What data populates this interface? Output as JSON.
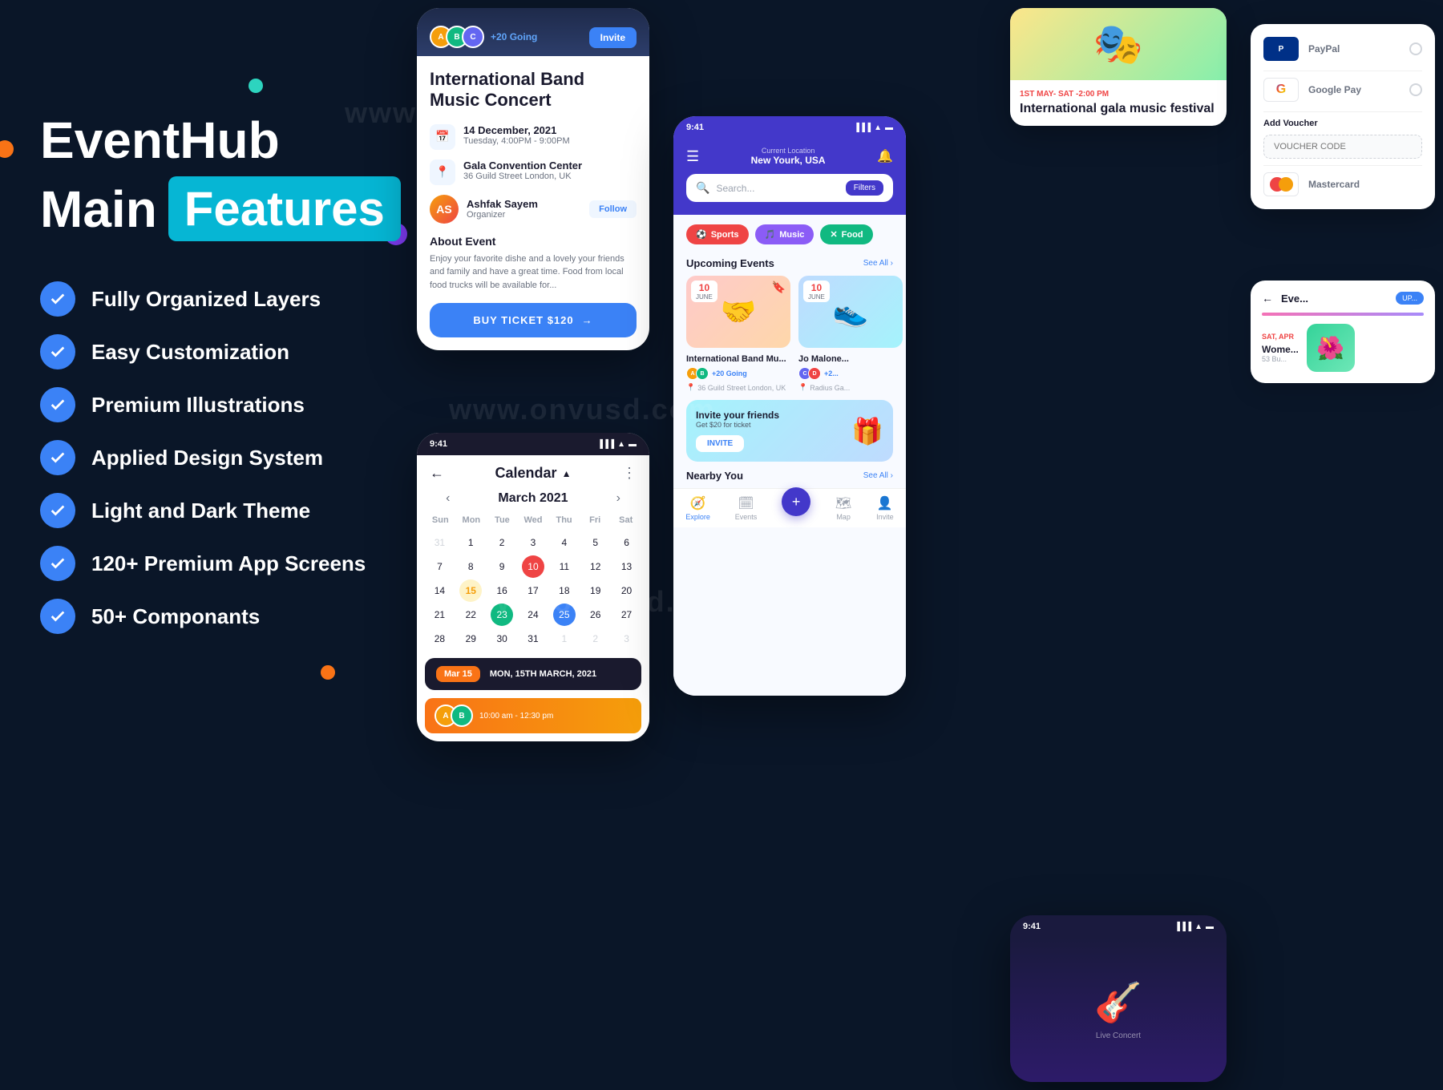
{
  "app": {
    "name": "EventHub",
    "subtitle": "Main",
    "badge": "Features"
  },
  "features": [
    {
      "label": "Fully Organized Layers"
    },
    {
      "label": "Easy Customization"
    },
    {
      "label": "Premium Illustrations"
    },
    {
      "label": "Applied Design System"
    },
    {
      "label": "Light and Dark Theme"
    },
    {
      "label": "120+ Premium App Screens"
    },
    {
      "label": "50+ Componants"
    }
  ],
  "phone1": {
    "going_text": "+20 Going",
    "invite_label": "Invite",
    "event_title": "International Band Music Concert",
    "date": "14 December, 2021",
    "date_sub": "Tuesday, 4:00PM - 9:00PM",
    "venue": "Gala Convention Center",
    "venue_sub": "36 Guild Street London, UK",
    "organizer": "Ashfak Sayem",
    "organizer_role": "Organizer",
    "follow_label": "Follow",
    "about_title": "About Event",
    "about_text": "Enjoy your favorite dishe and a lovely your friends and family and have a great time. Food from local food trucks will be available for...",
    "buy_label": "BUY TICKET $120"
  },
  "phone2": {
    "time": "9:41",
    "cal_title": "Calendar",
    "month": "March 2021",
    "days": [
      "Sun",
      "Mon",
      "Tue",
      "Wed",
      "Thu",
      "Fri",
      "Sat"
    ],
    "selected_date_label": "Mar 15",
    "selected_day_text": "MON, 15TH MARCH, 2021",
    "event_time": "10:00 am - 12:30 pm"
  },
  "phone3": {
    "time": "9:41",
    "location_label": "Current Location",
    "location": "New Yourk, USA",
    "search_placeholder": "Search...",
    "filter_label": "Filters",
    "categories": [
      {
        "label": "Sports",
        "color": "red"
      },
      {
        "label": "Music",
        "color": "purple"
      },
      {
        "label": "Food",
        "color": "green"
      }
    ],
    "upcoming_title": "Upcoming Events",
    "see_all": "See All",
    "events": [
      {
        "name": "International Band Mu...",
        "date_num": "10",
        "date_month": "JUNE",
        "going": "+20 Going",
        "location": "36 Guild Street London, UK"
      },
      {
        "name": "Jo Malone...",
        "date_num": "10",
        "date_month": "JUNE",
        "going": "+2...",
        "location": "Radius Ga..."
      }
    ],
    "invite_title": "Invite your friends",
    "invite_desc": "Get $20 for ticket",
    "invite_btn": "INVITE",
    "nearby_title": "Nearby You",
    "nav": [
      "Explore",
      "Events",
      "Map",
      "Invite"
    ]
  },
  "top_right": {
    "date": "1ST MAY- SAT -2:00 PM",
    "name": "International gala music festival"
  },
  "payment": {
    "paypal_label": "PayPal",
    "google_label": "Google Pay",
    "add_voucher": "Add Voucher",
    "voucher_placeholder": "VOUCHER CODE",
    "mastercard_label": "Mastercard"
  },
  "women_event": {
    "date": "SAT, APR",
    "title": "Wome...",
    "location": "53 Bu...",
    "upcoming": "UP...",
    "back_title": "Eve..."
  },
  "colors": {
    "bg": "#0a1628",
    "primary": "#3b82f6",
    "accent_cyan": "#06b6d4",
    "accent_purple": "#4338ca"
  }
}
